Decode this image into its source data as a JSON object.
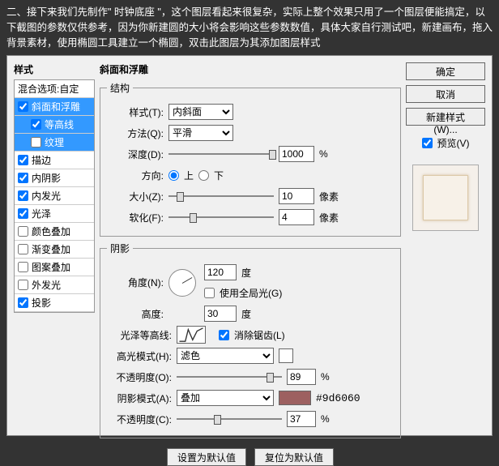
{
  "intro": "二、接下来我们先制作\" 时钟底座 \"，这个图层看起来很复杂，实际上整个效果只用了一个图层便能搞定，以下截图的参数仅供参考，因为你新建圆的大小将会影响这些参数数值，具体大家自行测试吧，新建画布，拖入背景素材，使用椭圆工具建立一个椭圆，双击此图层为其添加图层样式",
  "left": {
    "title": "样式",
    "blend": "混合选项:自定",
    "items": [
      {
        "l": "斜面和浮雕",
        "c": true,
        "sel": true
      },
      {
        "l": "等高线",
        "c": true,
        "sel": true,
        "i": true
      },
      {
        "l": "纹理",
        "c": false,
        "sel": true,
        "i": true
      },
      {
        "l": "描边",
        "c": true
      },
      {
        "l": "内阴影",
        "c": true
      },
      {
        "l": "内发光",
        "c": true
      },
      {
        "l": "光泽",
        "c": true
      },
      {
        "l": "颜色叠加",
        "c": false
      },
      {
        "l": "渐变叠加",
        "c": false
      },
      {
        "l": "图案叠加",
        "c": false
      },
      {
        "l": "外发光",
        "c": false
      },
      {
        "l": "投影",
        "c": true
      }
    ]
  },
  "mid": {
    "title": "斜面和浮雕",
    "struct": {
      "legend": "结构",
      "style_l": "样式(T):",
      "style_v": "内斜面",
      "method_l": "方法(Q):",
      "method_v": "平滑",
      "depth_l": "深度(D):",
      "depth_v": "1000",
      "pct": "%",
      "dir_l": "方向:",
      "up": "上",
      "down": "下",
      "size_l": "大小(Z):",
      "size_v": "10",
      "px": "像素",
      "soft_l": "软化(F):",
      "soft_v": "4"
    },
    "shadow": {
      "legend": "阴影",
      "angle_l": "角度(N):",
      "angle_v": "120",
      "deg": "度",
      "global_l": "使用全局光(G)",
      "alt_l": "高度:",
      "alt_v": "30",
      "gloss_l": "光泽等高线:",
      "aa_l": "消除锯齿(L)",
      "hi_mode_l": "高光模式(H):",
      "hi_mode_v": "滤色",
      "hi_op_l": "不透明度(O):",
      "hi_op_v": "89",
      "sh_mode_l": "阴影模式(A):",
      "sh_mode_v": "叠加",
      "sh_color": "#9d6060",
      "sh_op_l": "不透明度(C):",
      "sh_op_v": "37"
    },
    "btn1": "设置为默认值",
    "btn2": "复位为默认值"
  },
  "right": {
    "ok": "确定",
    "cancel": "取消",
    "new": "新建样式(W)...",
    "preview": "预览(V)"
  }
}
